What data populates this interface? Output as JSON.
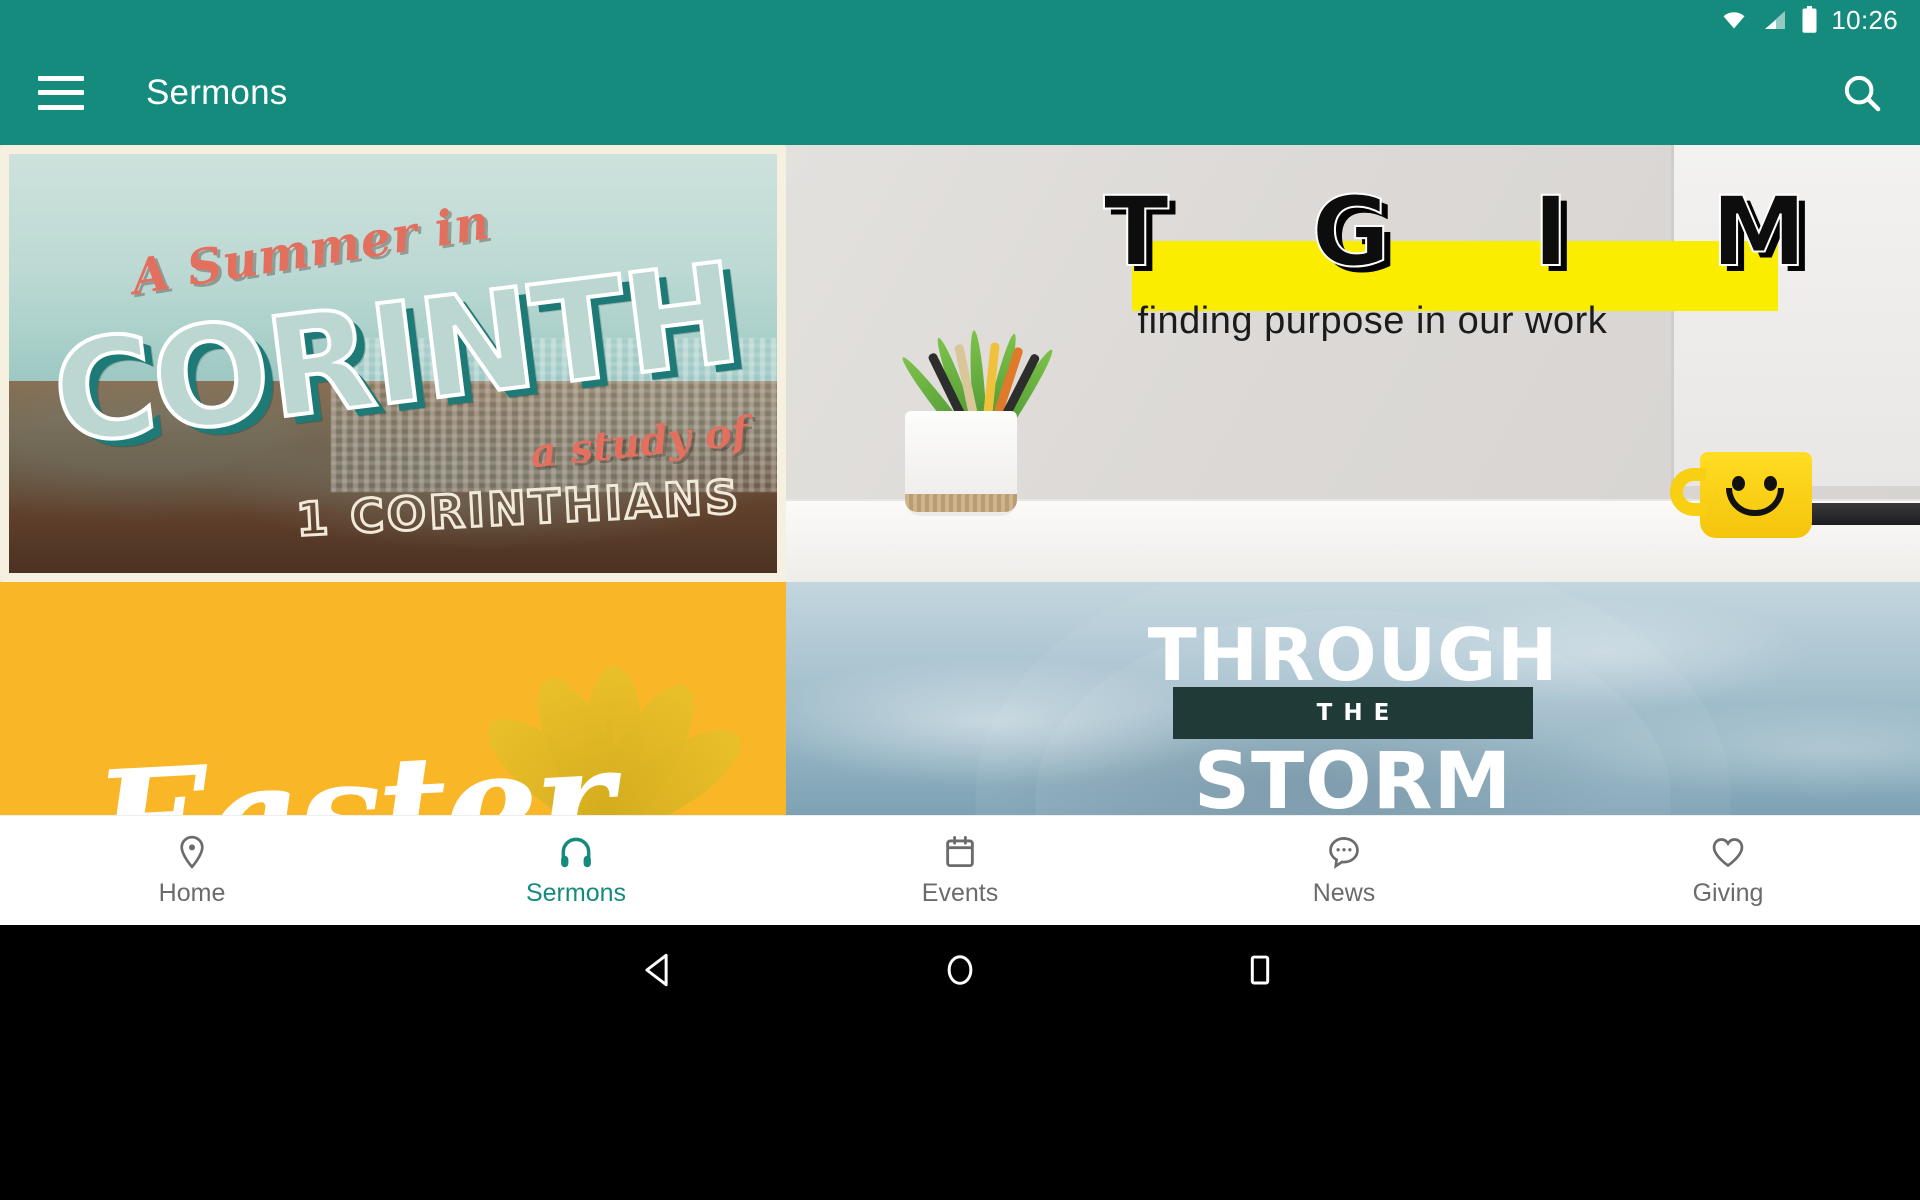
{
  "status_bar": {
    "time": "10:26",
    "icons": [
      "wifi-icon",
      "cellular-signal-icon",
      "battery-icon"
    ],
    "background_color": "#148B7D"
  },
  "app_bar": {
    "menu_icon": "hamburger-menu-icon",
    "title": "Sermons",
    "search_icon": "search-icon",
    "background_color": "#148B7D",
    "text_color": "#FFFFFF"
  },
  "sermon_series": [
    {
      "id": "corinth",
      "name": "A Summer in Corinth",
      "header_script": "A Summer in",
      "big_word": "CORINTH",
      "sub_script": "a study of",
      "sub_bold": "1 CORINTHIANS",
      "style": "vintage postcard",
      "accent_color": "#E3705E"
    },
    {
      "id": "tgim",
      "name": "TGIM",
      "letters": [
        "T",
        "G",
        "I",
        "M"
      ],
      "subtitle": "finding purpose in our work",
      "highlight_color": "#FAED00",
      "style": "office desk photo"
    },
    {
      "id": "easter",
      "name": "Easter",
      "word": "Easter",
      "background_color": "#F9B728",
      "text_color": "#FFFFFF"
    },
    {
      "id": "storm",
      "name": "Through the Storm",
      "line1": "THROUGH",
      "line2": "THE",
      "line3": "STORM",
      "bar_color": "#203A38",
      "style": "cloudy sky photo"
    }
  ],
  "bottom_nav": {
    "active": "Sermons",
    "active_color": "#148B7D",
    "inactive_color": "#6B6B6B",
    "items": [
      {
        "label": "Home",
        "icon": "location-pin-icon"
      },
      {
        "label": "Sermons",
        "icon": "headphones-icon"
      },
      {
        "label": "Events",
        "icon": "calendar-icon"
      },
      {
        "label": "News",
        "icon": "chat-bubble-icon"
      },
      {
        "label": "Giving",
        "icon": "heart-icon"
      }
    ]
  },
  "android_nav": {
    "buttons": [
      {
        "name": "back-button",
        "icon": "triangle-left-icon"
      },
      {
        "name": "home-button",
        "icon": "circle-icon"
      },
      {
        "name": "recents-button",
        "icon": "square-icon"
      }
    ],
    "background_color": "#000000"
  }
}
